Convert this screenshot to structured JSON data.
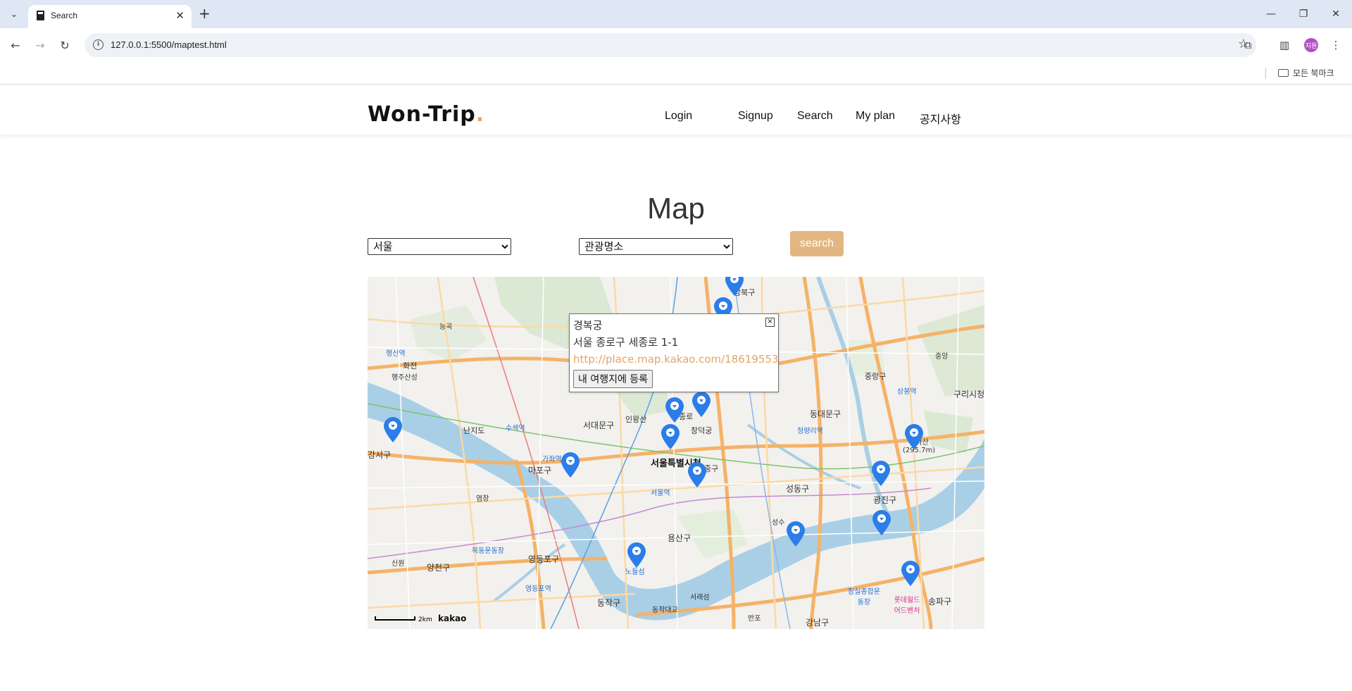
{
  "browser": {
    "tab_title": "Search",
    "url": "127.0.0.1:5500/maptest.html",
    "bookmarks_label": "모든 북마크",
    "profile_initials": "지원"
  },
  "header": {
    "logo_text": "Won-Trip",
    "logo_dot": ".",
    "nav": [
      "Login",
      "Signup",
      "Search",
      "My plan",
      "공지사항"
    ]
  },
  "page": {
    "title": "Map",
    "region_select": "서울",
    "category_select": "관광명소",
    "search_label": "search"
  },
  "map": {
    "infowindow": {
      "name": "경복궁",
      "address": "서울 종로구 세종로 1-1",
      "link": "http://place.map.kakao.com/18619553",
      "button_label": "내 여행지에 등록",
      "close_symbol": "×"
    },
    "labels": [
      "강북구",
      "중랑구",
      "구리시청",
      "동대문구",
      "성동구",
      "광진구",
      "용산구",
      "서대문구",
      "마포구",
      "종로",
      "창덕궁",
      "서울특별시청",
      "중구",
      "서울역",
      "영등포구",
      "영등포역",
      "동작구",
      "양천구",
      "강서구",
      "행신역",
      "화전",
      "강남구",
      "송파구",
      "청량리역",
      "상봉역",
      "아차산 (295.7m)",
      "롯데월드 어드벤처",
      "잠실종합운동장",
      "목동운동장",
      "인왕산",
      "난지도",
      "수색역",
      "가좌역",
      "노들섬",
      "서래섬",
      "동작대교",
      "반포",
      "성수",
      "중앙",
      "신원",
      "염창",
      "능곡",
      "행주산성",
      "난지도"
    ],
    "scale_text": "2km",
    "provider": "kakao",
    "marker_color": "#2b7de9"
  },
  "colors": {
    "accent": "#e3b681",
    "link": "#e3a567",
    "river": "#a9cfe6",
    "main_road": "#f5b267"
  }
}
